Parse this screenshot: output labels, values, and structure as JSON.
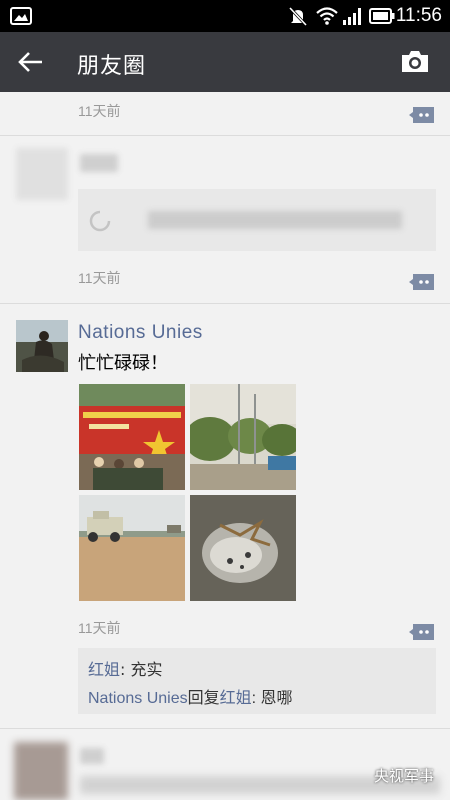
{
  "status_bar": {
    "time": "11:56",
    "icons": [
      "image-icon",
      "mute-icon",
      "wifi-icon",
      "signal-icon",
      "battery-icon"
    ]
  },
  "nav": {
    "title": "朋友圈",
    "back_icon": "back-arrow-icon",
    "camera_icon": "camera-icon"
  },
  "posts": [
    {
      "time": "11天前"
    },
    {
      "time": "11天前",
      "blurred": true
    },
    {
      "author": "Nations  Unies",
      "text": "忙忙碌碌！",
      "time": "11天前",
      "photos": [
        "banner-photo",
        "trees-photo",
        "armored-vehicle-photo",
        "ground-debris-photo"
      ],
      "comments": [
        {
          "author": "红姐",
          "sep": ": ",
          "text": "充实"
        },
        {
          "author": "Nations  Unies",
          "reply_word": "回复",
          "reply_to": "红姐",
          "sep": ": ",
          "text": "恩哪"
        }
      ]
    }
  ],
  "watermark": "央视军事",
  "colors": {
    "nav_bg": "#393a3f",
    "name_blue": "#576b95",
    "feed_bg": "#f2f2f2"
  }
}
